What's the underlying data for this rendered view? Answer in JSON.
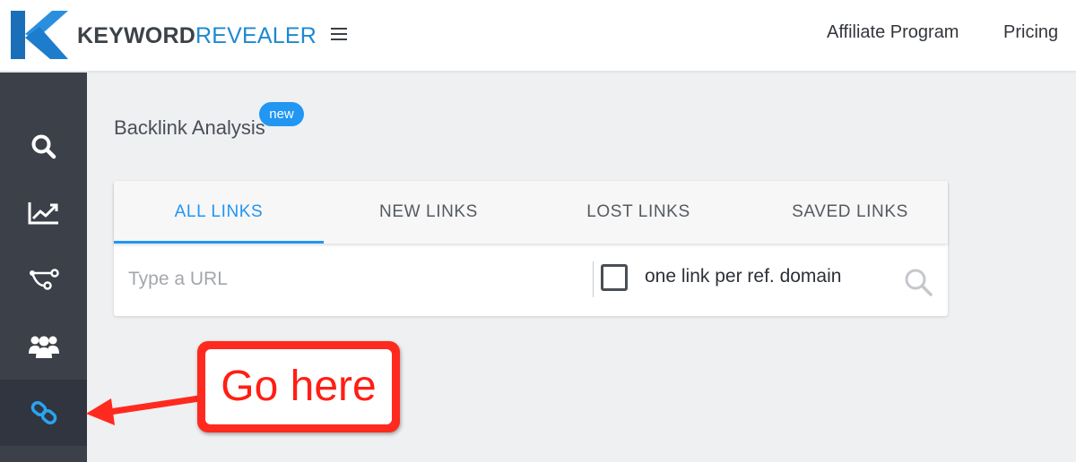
{
  "header": {
    "brand_part1": "KEYWORD",
    "brand_part2": "REVEALER",
    "menu_icon": "hamburger-icon",
    "nav": [
      "Affiliate Program",
      "Pricing"
    ]
  },
  "sidebar": {
    "items": [
      {
        "icon": "search-icon",
        "active": false
      },
      {
        "icon": "chart-line-icon",
        "active": false
      },
      {
        "icon": "network-icon",
        "active": false
      },
      {
        "icon": "users-icon",
        "active": false
      },
      {
        "icon": "link-icon",
        "active": true
      }
    ]
  },
  "main": {
    "title": "Backlink Analysis",
    "badge": "new",
    "tabs": [
      {
        "label": "ALL LINKS",
        "active": true
      },
      {
        "label": "NEW LINKS",
        "active": false
      },
      {
        "label": "LOST LINKS",
        "active": false
      },
      {
        "label": "SAVED LINKS",
        "active": false
      }
    ],
    "url_input": {
      "placeholder": "Type a URL",
      "value": ""
    },
    "checkbox": {
      "label": "one link per ref. domain",
      "checked": false
    }
  },
  "annotation": {
    "text": "Go here"
  },
  "colors": {
    "accent": "#2196f3",
    "sidebar": "#3b4049",
    "annotation": "#ff2a1f"
  }
}
